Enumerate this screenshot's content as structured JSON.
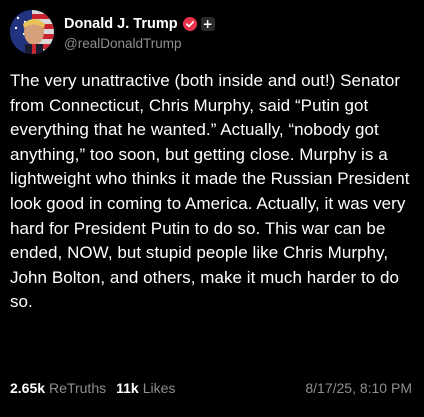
{
  "author": {
    "display_name": "Donald J. Trump",
    "handle": "@realDonaldTrump",
    "plus_label": "+"
  },
  "post": {
    "text": "The very unattractive (both inside and out!) Senator from Connecticut, Chris Murphy, said “Putin got everything that he wanted.” Actually, “nobody got anything,” too soon, but getting close. Murphy is a lightweight who thinks it made the Russian President look good in coming to America. Actually, it was very hard for President Putin to do so. This war can be ended, NOW, but stupid people like Chris Murphy, John Bolton, and others, make it much harder to do so."
  },
  "stats": {
    "retruths_count": "2.65k",
    "retruths_label": "ReTruths",
    "likes_count": "11k",
    "likes_label": "Likes"
  },
  "timestamp": "8/17/25, 8:10 PM",
  "colors": {
    "background": "#000000",
    "text": "#ffffff",
    "muted": "#8e8e93",
    "verified_badge": "#e8334a"
  },
  "icons": {
    "verified": "verified-badge-icon",
    "plus": "plus-icon"
  }
}
